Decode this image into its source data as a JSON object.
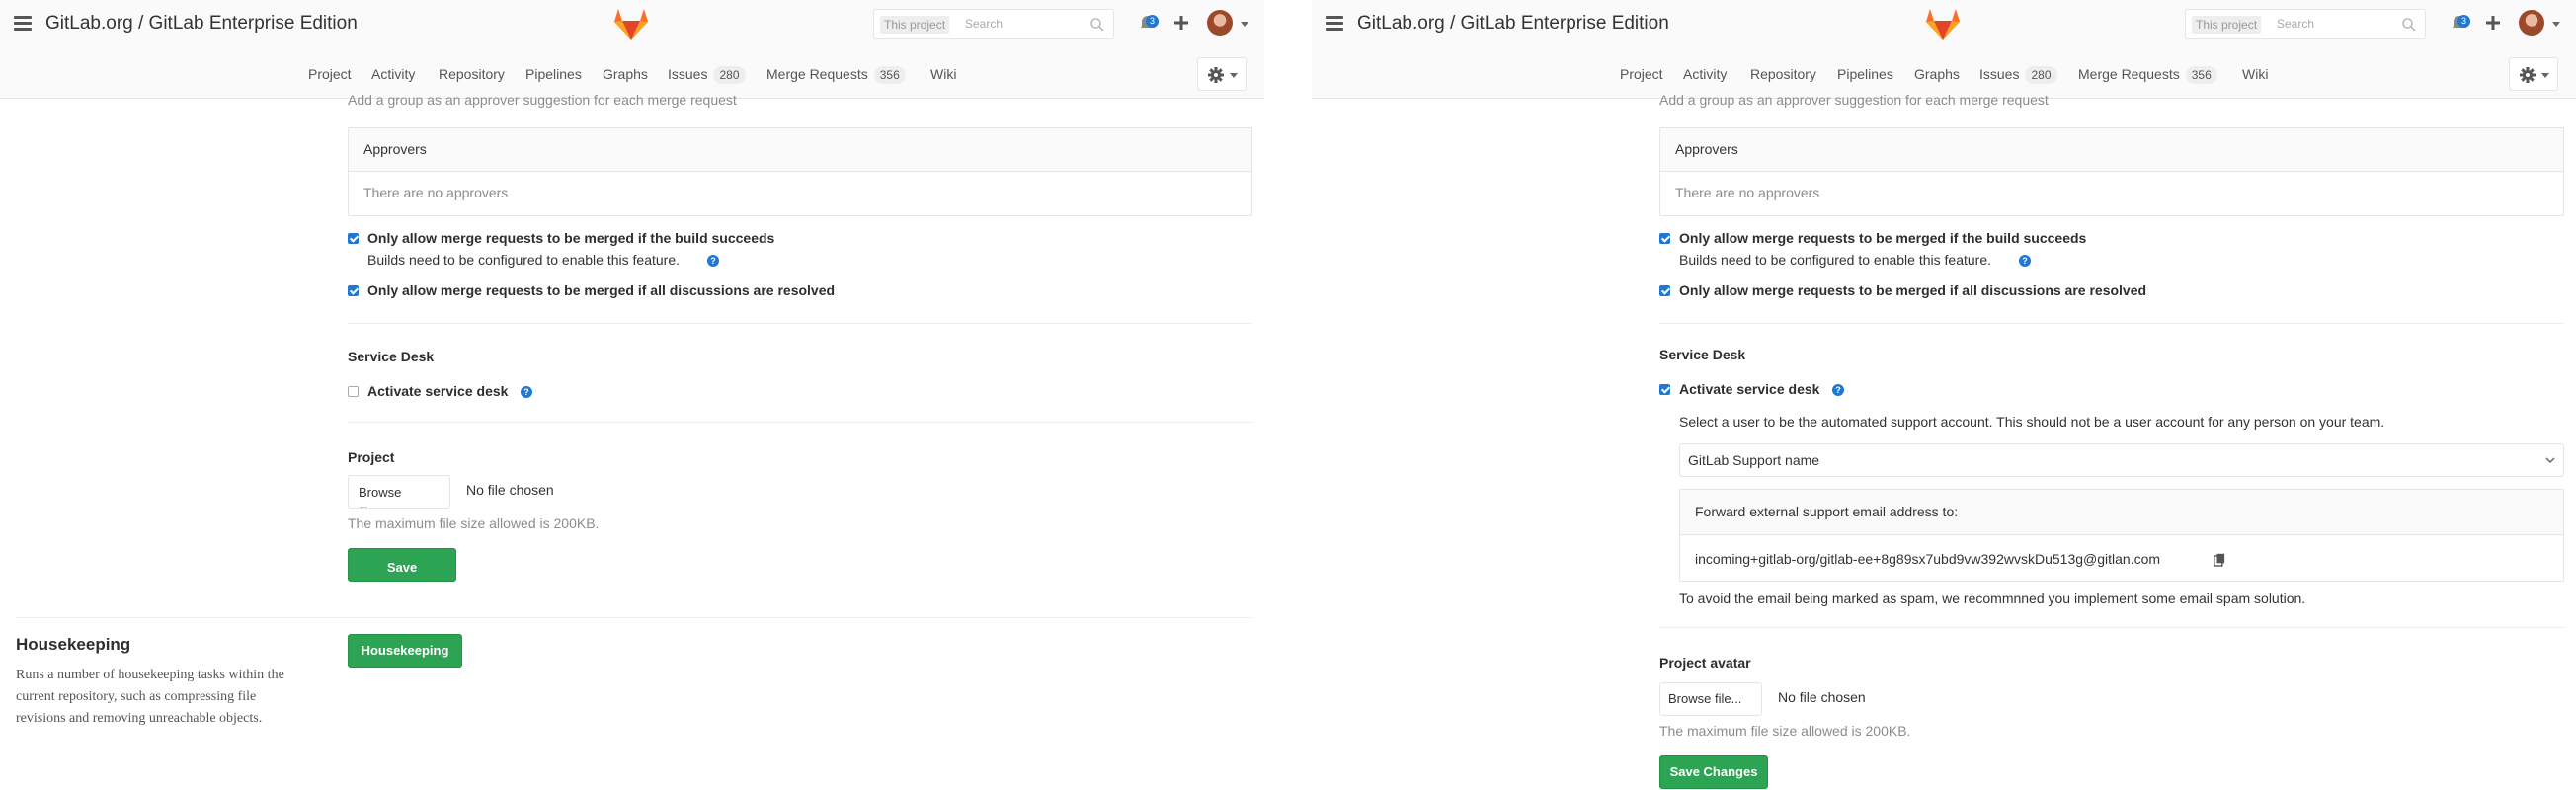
{
  "header": {
    "title": "GitLab.org / GitLab Enterprise Edition",
    "search_scope": "This project",
    "search_placeholder": "Search",
    "todo_count": "3"
  },
  "nav": {
    "items": [
      "Project",
      "Activity",
      "Repository",
      "Pipelines",
      "Graphs",
      "Issues",
      "Merge Requests",
      "Wiki"
    ],
    "issues_count": "280",
    "mr_count": "356"
  },
  "approvers": {
    "hint": "Add a group as an approver suggestion for each merge request",
    "heading": "Approvers",
    "empty": "There are no approvers"
  },
  "merge_options": {
    "build_label": "Only allow merge requests to be merged if the build succeeds",
    "build_help": "Builds need to be configured to enable this feature.",
    "discussions_label": "Only allow merge requests to be merged if all discussions are resolved"
  },
  "service_desk": {
    "heading": "Service Desk",
    "activate_label": "Activate service desk",
    "select_user_text": "Select a user to be the automated support account. This should not be a user account for any person on your team.",
    "user_select_value": "GitLab Support name",
    "forward_heading": "Forward external support email address to:",
    "email": "incoming+gitlab-org/gitlab-ee+8g89sx7ubd9vw392wvskDu513g@gitlan.com",
    "spam_note": "To avoid the email being marked as spam, we recommnned you implement some email spam solution."
  },
  "left": {
    "avatar_heading": "Project\navatar",
    "browse_label": "Browse\nfile...",
    "save_label": "Save\nChanges"
  },
  "right": {
    "avatar_heading": "Project avatar",
    "browse_label": "Browse file...",
    "save_label": "Save Changes"
  },
  "avatar": {
    "no_file": "No file chosen",
    "max_size": "The maximum file size allowed is 200KB."
  },
  "housekeeping": {
    "heading": "Housekeeping",
    "description": "Runs a number of housekeeping tasks within the current repository, such as compressing file revisions and removing unreachable objects.",
    "button": "Housekeeping"
  },
  "colors": {
    "accent": "#1f78d1",
    "success": "#2ca454"
  }
}
